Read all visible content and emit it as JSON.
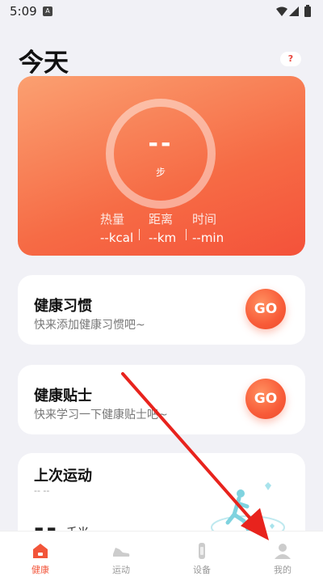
{
  "status": {
    "time": "5:09",
    "notif_badge": "A"
  },
  "header": {
    "title": "今天",
    "help_label": "?"
  },
  "hero": {
    "steps_value": "--",
    "steps_unit": "步",
    "metrics": [
      {
        "label": "热量",
        "value": "--kcal"
      },
      {
        "label": "距离",
        "value": "--km"
      },
      {
        "label": "时间",
        "value": "--min"
      }
    ]
  },
  "habits": {
    "title": "健康习惯",
    "subtitle": "快来添加健康习惯吧~",
    "go_label": "GO"
  },
  "tips": {
    "title": "健康贴士",
    "subtitle": "快来学习一下健康贴士吧~",
    "go_label": "GO"
  },
  "last_workout": {
    "title": "上次运动",
    "date": "-- --",
    "distance": "--",
    "unit": "千米"
  },
  "nav": {
    "items": [
      {
        "label": "健康",
        "icon": "home-icon"
      },
      {
        "label": "运动",
        "icon": "shoe-icon"
      },
      {
        "label": "设备",
        "icon": "band-icon"
      },
      {
        "label": "我的",
        "icon": "user-icon"
      }
    ]
  },
  "colors": {
    "accent": "#f2553a",
    "annotation_arrow": "#e8231d"
  }
}
